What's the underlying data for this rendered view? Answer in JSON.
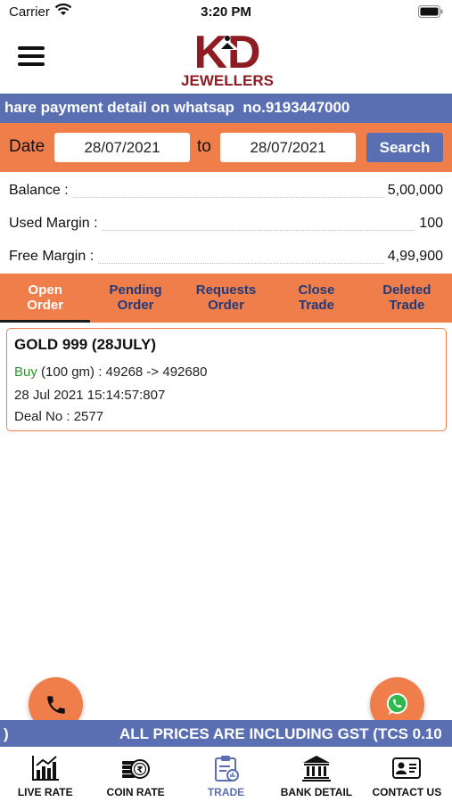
{
  "status_bar": {
    "carrier": "Carrier",
    "time": "3:20 PM"
  },
  "header": {
    "logo_text": "KD",
    "logo_subtitle": "JEWELLERS"
  },
  "marquee_top": "hare payment detail on whatsap  no.9193447000",
  "date_filter": {
    "date_label": "Date",
    "from_value": "28/07/2021",
    "to_label": "to",
    "to_value": "28/07/2021",
    "search_label": "Search"
  },
  "summary": {
    "balance_label": "Balance :",
    "balance_value": "5,00,000",
    "used_margin_label": "Used Margin :",
    "used_margin_value": "100",
    "free_margin_label": "Free Margin :",
    "free_margin_value": "4,99,900"
  },
  "tabs": [
    {
      "line1": "Open",
      "line2": "Order",
      "active": true
    },
    {
      "line1": "Pending",
      "line2": "Order",
      "active": false
    },
    {
      "line1": "Requests",
      "line2": "Order",
      "active": false
    },
    {
      "line1": "Close",
      "line2": "Trade",
      "active": false
    },
    {
      "line1": "Deleted",
      "line2": "Trade",
      "active": false
    }
  ],
  "order": {
    "title": "GOLD 999 (28JULY)",
    "side": "Buy",
    "trade_detail": " (100 gm) : 49268 -> 492680",
    "datetime": "28 Jul 2021 15:14:57:807",
    "deal_no": "Deal No : 2577"
  },
  "marquee_bottom": {
    "lead": ")",
    "main": "ALL PRICES ARE INCLUDING GST (TCS 0.10"
  },
  "bottom_nav": [
    {
      "label": "LIVE RATE",
      "icon": "chart-icon",
      "active": false
    },
    {
      "label": "COIN RATE",
      "icon": "coins-icon",
      "active": false
    },
    {
      "label": "TRADE",
      "icon": "trade-clipboard-icon",
      "active": true
    },
    {
      "label": "BANK DETAIL",
      "icon": "bank-icon",
      "active": false
    },
    {
      "label": "CONTACT US",
      "icon": "contact-card-icon",
      "active": false
    }
  ],
  "colors": {
    "accent_orange": "#ef7e4b",
    "brand_blue": "#5a6fb2",
    "logo_red": "#8e1c22",
    "buy_green": "#2a9a2a"
  }
}
